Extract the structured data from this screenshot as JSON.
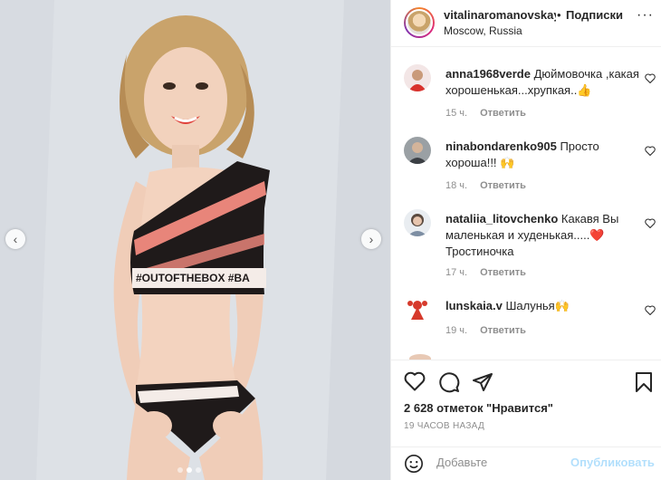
{
  "post": {
    "username": "vitalinaromanovskaya",
    "separator": "•",
    "follow_label": "Подписки",
    "location": "Moscow, Russia",
    "more_label": "···"
  },
  "photo": {
    "nav_prev": "‹",
    "nav_next": "›",
    "print_text": "#OUTOFTHEBOX #BA",
    "pages": 3,
    "current_page": 2
  },
  "comments": [
    {
      "user": "anna1968verde",
      "text": "Дюймовочка ,какая хорошенькая...хрупкая..👍",
      "time": "15 ч.",
      "reply": "Ответить"
    },
    {
      "user": "ninabondarenko905",
      "text": "Просто хороша!!! 🙌",
      "time": "18 ч.",
      "reply": "Ответить"
    },
    {
      "user": "nataliia_litovchenko",
      "text": "Какавя Вы маленькая и худенькая.....❤️ Тростиночка",
      "time": "17 ч.",
      "reply": "Ответить"
    },
    {
      "user": "lunskaia.v",
      "text": "Шалунья🙌",
      "time": "19 ч.",
      "reply": "Ответить"
    }
  ],
  "stats": {
    "likes": "2 628 отметок \"Нравится\"",
    "time_ago": "19 ЧАСОВ НАЗАД"
  },
  "composer": {
    "placeholder": "Добавьте",
    "publish_label": "Опубликовать"
  },
  "colors": {
    "publish_disabled": "#b2dffc",
    "muted": "#8e8e8e",
    "text": "#262626",
    "heart_red": "#ed4956"
  }
}
